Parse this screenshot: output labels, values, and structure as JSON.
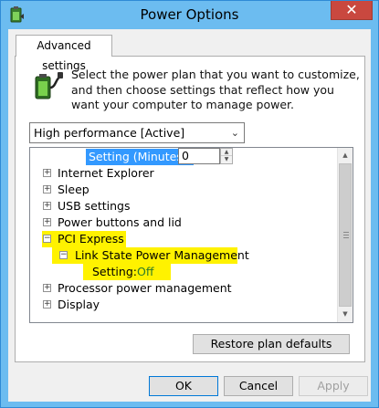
{
  "window": {
    "title": "Power Options",
    "close_glyph": "✕"
  },
  "tabs": [
    {
      "label": "Advanced settings"
    }
  ],
  "description": "Select the power plan that you want to customize, and then choose settings that reflect how you want your computer to manage power.",
  "plan_select": {
    "value": "High performance [Active]",
    "chevron": "⌄"
  },
  "tree": {
    "top_setting": {
      "label": "Setting (Minutes):",
      "value": "0"
    },
    "items": [
      {
        "label": "Internet Explorer",
        "expander": "+"
      },
      {
        "label": "Sleep",
        "expander": "+"
      },
      {
        "label": "USB settings",
        "expander": "+"
      },
      {
        "label": "Power buttons and lid",
        "expander": "+"
      },
      {
        "label": "PCI Express",
        "expander": "−",
        "highlighted": true
      },
      {
        "label": "Link State Power Management",
        "expander": "−",
        "highlighted": true
      },
      {
        "label": "Setting:",
        "value": "Off",
        "highlighted": true
      },
      {
        "label": "Processor power management",
        "expander": "+"
      },
      {
        "label": "Display",
        "expander": "+"
      }
    ],
    "highlight_color": "#fff200"
  },
  "buttons": {
    "restore": "Restore plan defaults",
    "ok": "OK",
    "cancel": "Cancel",
    "apply": "Apply"
  },
  "colors": {
    "title_bar": "#6cbcf0",
    "close_button": "#c9483f",
    "selection": "#3399ff"
  },
  "icons": {
    "app": "power-options-icon",
    "battery": "battery-plug-icon"
  }
}
